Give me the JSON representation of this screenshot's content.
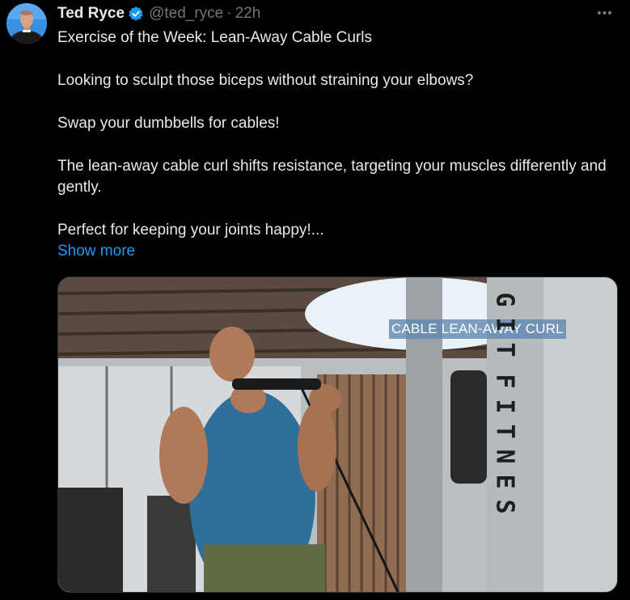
{
  "author": {
    "name": "Ted Ryce",
    "handle": "@ted_ryce",
    "separator": "·",
    "time": "22h",
    "verified": true
  },
  "more_icon": "more-horizontal-icon",
  "post": {
    "title": "Exercise of the Week: Lean-Away Cable Curls",
    "p1": "Looking to sculpt those biceps without straining your elbows?",
    "p2": "Swap your dumbbells for cables!",
    "p3": "The lean-away cable curl shifts resistance, targeting your muscles differently and gently.",
    "p4": "Perfect for keeping your joints happy!...",
    "show_more": "Show more"
  },
  "media": {
    "overlay_text": "CABLE LEAN-AWAY CURL",
    "brand_letters": [
      "G",
      "I",
      "T",
      "F",
      "I",
      "T",
      "N",
      "E",
      "S"
    ]
  },
  "colors": {
    "background": "#000000",
    "text": "#e7e9ea",
    "secondary": "#71767b",
    "link": "#1d9bf0",
    "verified_badge": "#1d9bf0"
  }
}
